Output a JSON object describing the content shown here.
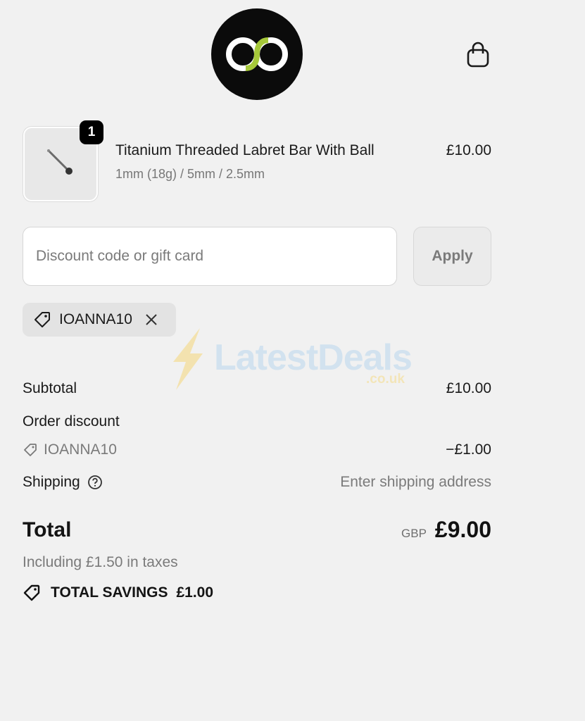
{
  "header": {
    "logo_icon": "infinity-logo-icon",
    "cart_icon": "shopping-bag-icon"
  },
  "line_item": {
    "quantity": "1",
    "title": "Titanium Threaded Labret Bar With Ball",
    "variant": "1mm (18g) / 5mm / 2.5mm",
    "price": "£10.00",
    "image_icon": "labret-bar-icon"
  },
  "discount": {
    "placeholder": "Discount code or gift card",
    "value": "",
    "apply_label": "Apply",
    "applied_code": "IOANNA10"
  },
  "watermark": {
    "text": "LatestDeals",
    "sub": ".co.uk"
  },
  "summary": {
    "subtotal_label": "Subtotal",
    "subtotal_value": "£10.00",
    "order_discount_label": "Order discount",
    "discount_code": "IOANNA10",
    "discount_value": "−£1.00",
    "shipping_label": "Shipping",
    "shipping_value": "Enter shipping address",
    "total_label": "Total",
    "currency": "GBP",
    "total_value": "£9.00",
    "tax_text": "Including £1.50 in taxes",
    "savings_label": "TOTAL SAVINGS",
    "savings_value": "£1.00"
  },
  "colors": {
    "background": "#f1f1f1",
    "logo_bg": "#0b0b0b",
    "logo_accent": "#a6c83a",
    "muted_text": "#7a7a7a"
  }
}
